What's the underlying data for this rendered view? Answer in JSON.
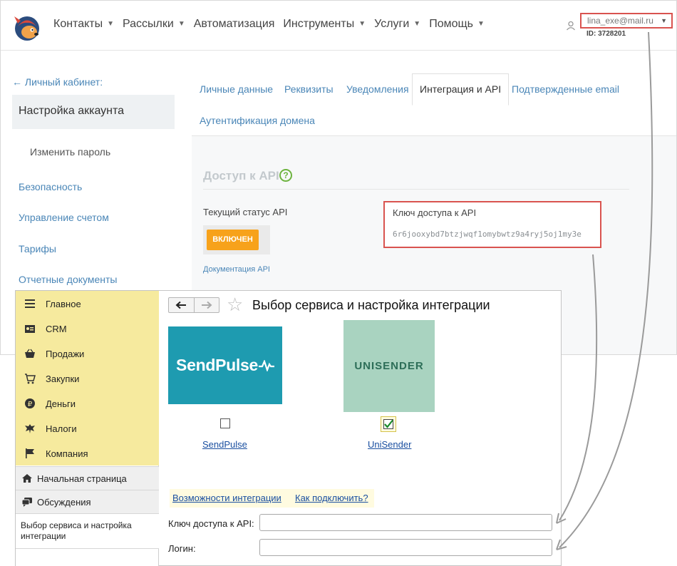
{
  "web": {
    "nav": [
      {
        "label": "Контакты",
        "caret": true
      },
      {
        "label": "Рассылки",
        "caret": true
      },
      {
        "label": "Автоматизация",
        "caret": false
      },
      {
        "label": "Инструменты",
        "caret": true
      },
      {
        "label": "Услуги",
        "caret": true
      },
      {
        "label": "Помощь",
        "caret": true
      }
    ],
    "user": {
      "email": "lina_exe@mail.ru",
      "id": "ID: 3728201"
    },
    "back_link": "← Личный кабинет:",
    "account_title": "Настройка аккаунта",
    "sidebar": {
      "change_password": "Изменить пароль",
      "security": "Безопасность",
      "account": "Управление счетом",
      "tariffs": "Тарифы",
      "reports": "Отчетные документы"
    },
    "tabs": {
      "personal": "Личные данные",
      "requisites": "Реквизиты",
      "notifications": "Уведомления",
      "integration": "Интеграция и API",
      "confirmed_email": "Подтвержденные email",
      "domain_auth": "Аутентификация домена"
    },
    "api": {
      "title": "Доступ к API",
      "help": "?",
      "status_label": "Текущий статус API",
      "status_button": "ВКЛЮЧЕН",
      "doc_link": "Документация API",
      "key_label": "Ключ доступа к API",
      "key_value": "6r6jooxybd7btzjwqf1omybwtz9a4ryj5oj1my3e"
    }
  },
  "onec": {
    "menu": {
      "main": "Главное",
      "crm": "CRM",
      "sales": "Продажи",
      "purchases": "Закупки",
      "money": "Деньги",
      "taxes": "Налоги",
      "company": "Компания"
    },
    "home": "Начальная страница",
    "discussions": "Обсуждения",
    "current_page": "Выбор сервиса и настройка интеграции",
    "back": "🡐",
    "forward": "🡒",
    "star": "☆",
    "title": "Выбор сервиса и настройка интеграции",
    "services": {
      "sendpulse_logo": "SendPulse",
      "sendpulse_link": "SendPulse",
      "sendpulse_checked": false,
      "unisender_logo": "UNISENDER",
      "unisender_link": "UniSender",
      "unisender_checked": true
    },
    "links": {
      "features": "Возможности интеграции",
      "how_to": "Как подключить?"
    },
    "fields": {
      "api_key_label": "Ключ доступа к API:",
      "api_key_value": "",
      "login_label": "Логин:",
      "login_value": ""
    }
  },
  "colors": {
    "highlight_red": "#d9534f",
    "accent_orange": "#f7a21b",
    "link_blue": "#4a86b7",
    "onec_menu_yellow": "#f6ea9e",
    "sendpulse_teal": "#1e9bb0",
    "unisender_green": "#a9d3c0"
  }
}
